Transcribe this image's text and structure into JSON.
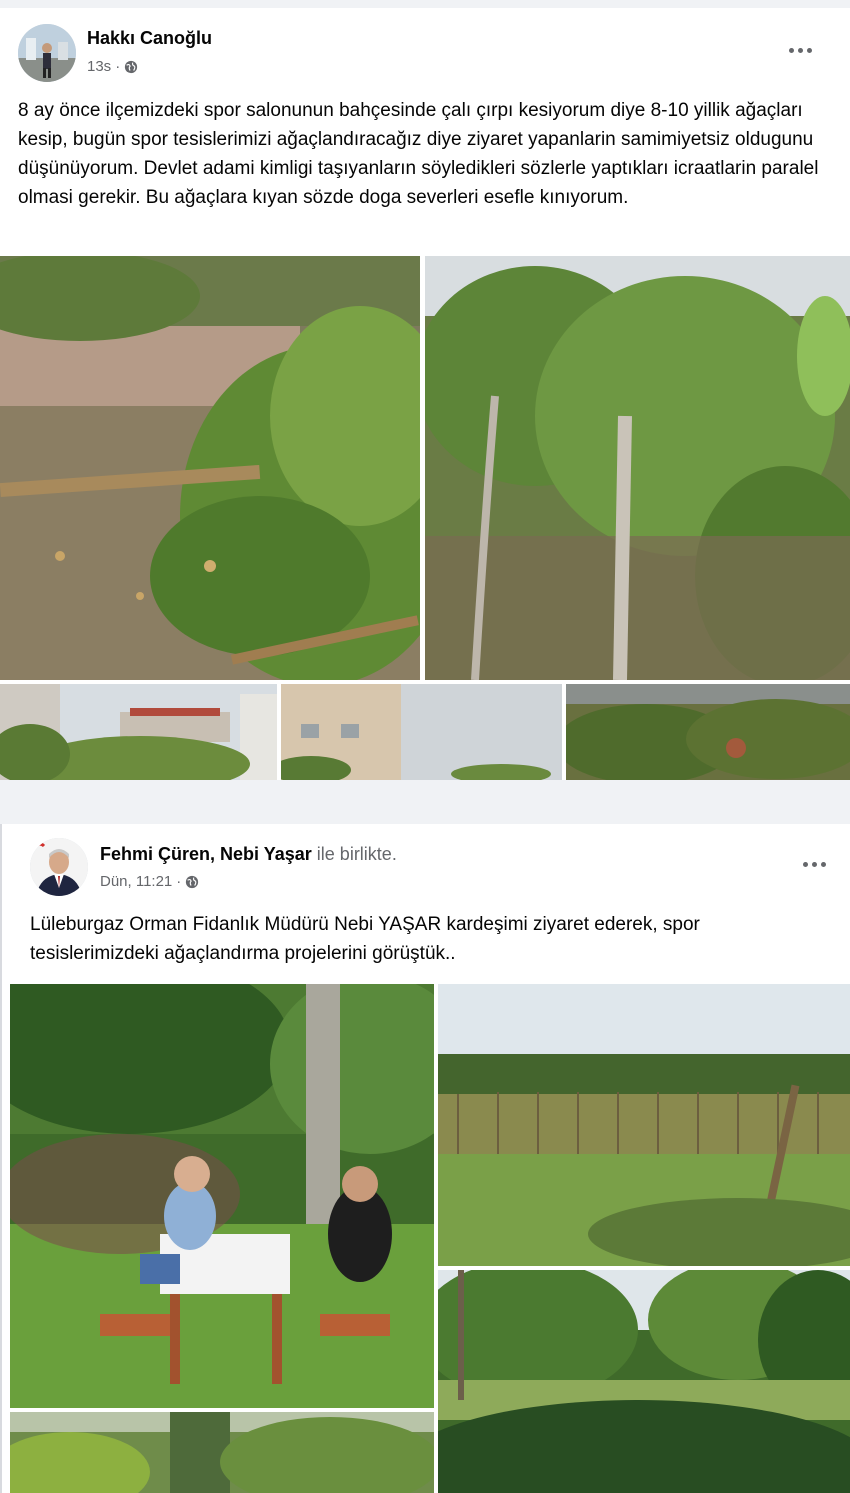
{
  "posts": [
    {
      "author": "Hakkı Canoğlu",
      "time": "13s",
      "separator": "·",
      "text": "8 ay önce ilçemizdeki spor salonunun bahçesinde çalı çırpı kesiyorum diye 8-10 yillik ağaçları kesip, bugün spor tesislerimizi ağaçlandıracağız diye ziyaret yapanlarin samimiyetsiz oldugunu düşünüyorum. Devlet adami kimligi taşıyanların söyledikleri sözlerle yaptıkları icraatlarin paralel olmasi gerekir. Bu ağaçlara kıyan sözde doga severleri esefle kınıyorum.",
      "privacy_icon": "globe-icon",
      "menu_icon": "more-options-icon"
    },
    {
      "author": "Fehmi Çüren",
      "tag_separator": ",",
      "tagged": "Nebi Yaşar",
      "with_text": "ile birlikte.",
      "time": "Dün, 11:21",
      "separator": "·",
      "text": "Lüleburgaz Orman Fidanlık Müdürü Nebi YAŞAR kardeşimi ziyaret ederek, spor tesislerimizdeki ağaçlandırma projelerini  görüştük..",
      "privacy_icon": "globe-icon",
      "menu_icon": "more-options-icon"
    }
  ],
  "colors": {
    "background": "#f0f2f5",
    "card": "#ffffff",
    "text": "#050505",
    "secondary": "#65676b"
  }
}
